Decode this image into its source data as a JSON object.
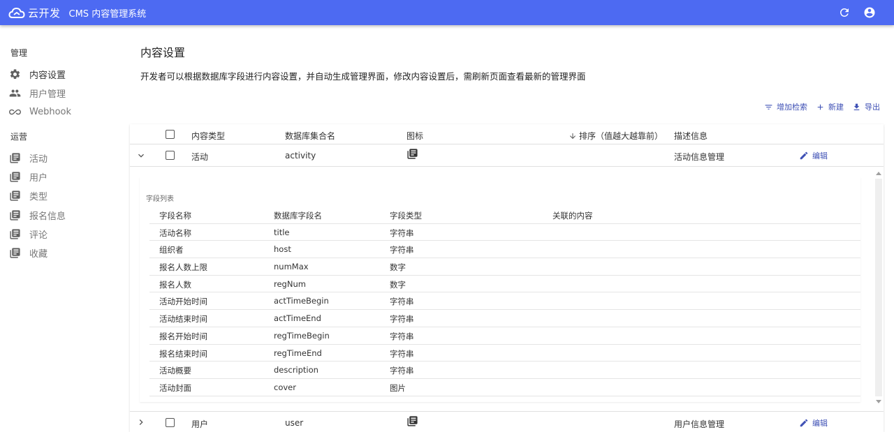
{
  "app": {
    "brand": "云开发",
    "title": "CMS 内容管理系统"
  },
  "topbar": {
    "refresh_icon": "refresh-icon",
    "account_icon": "account-circle-icon"
  },
  "sidebar": {
    "section_manage": "管理",
    "manage_items": [
      {
        "label": "内容设置",
        "icon": "gear-icon"
      },
      {
        "label": "用户管理",
        "icon": "people-icon"
      },
      {
        "label": "Webhook",
        "icon": "link-icon"
      }
    ],
    "section_ops": "运营",
    "ops_items": [
      {
        "label": "活动",
        "icon": "library-books-icon"
      },
      {
        "label": "用户",
        "icon": "library-books-icon"
      },
      {
        "label": "类型",
        "icon": "library-books-icon"
      },
      {
        "label": "报名信息",
        "icon": "library-books-icon"
      },
      {
        "label": "评论",
        "icon": "library-books-icon"
      },
      {
        "label": "收藏",
        "icon": "library-books-icon"
      }
    ]
  },
  "main": {
    "title": "内容设置",
    "description": "开发者可以根据数据库字段进行内容设置，并自动生成管理界面，修改内容设置后，需刷新页面查看最新的管理界面",
    "toolbar": {
      "filter_label": "增加检索",
      "new_label": "新建",
      "export_label": "导出"
    },
    "table": {
      "headers": {
        "type": "内容类型",
        "collection": "数据库集合名",
        "icon": "图标",
        "order": "排序（值越大越靠前）",
        "desc": "描述信息"
      },
      "rows": [
        {
          "type": "活动",
          "collection": "activity",
          "icon": "library-books-icon",
          "desc": "活动信息管理",
          "edit": "编辑",
          "expanded": true
        },
        {
          "type": "用户",
          "collection": "user",
          "icon": "library-books-icon",
          "desc": "用户信息管理",
          "edit": "编辑",
          "expanded": false
        }
      ]
    },
    "fields": {
      "title": "字段列表",
      "headers": {
        "name": "字段名称",
        "db": "数据库字段名",
        "type": "字段类型",
        "relation": "关联的内容"
      },
      "rows": [
        {
          "name": "活动名称",
          "db": "title",
          "type": "字符串"
        },
        {
          "name": "组织者",
          "db": "host",
          "type": "字符串"
        },
        {
          "name": "报名人数上限",
          "db": "numMax",
          "type": "数字"
        },
        {
          "name": "报名人数",
          "db": "regNum",
          "type": "数字"
        },
        {
          "name": "活动开始时间",
          "db": "actTimeBegin",
          "type": "字符串"
        },
        {
          "name": "活动结束时间",
          "db": "actTimeEnd",
          "type": "字符串"
        },
        {
          "name": "报名开始时间",
          "db": "regTimeBegin",
          "type": "字符串"
        },
        {
          "name": "报名结束时间",
          "db": "regTimeEnd",
          "type": "字符串"
        },
        {
          "name": "活动概要",
          "db": "description",
          "type": "字符串"
        },
        {
          "name": "活动封面",
          "db": "cover",
          "type": "图片"
        }
      ]
    }
  },
  "colors": {
    "topbar": "#4d6af2",
    "accent": "#3f51b5"
  }
}
